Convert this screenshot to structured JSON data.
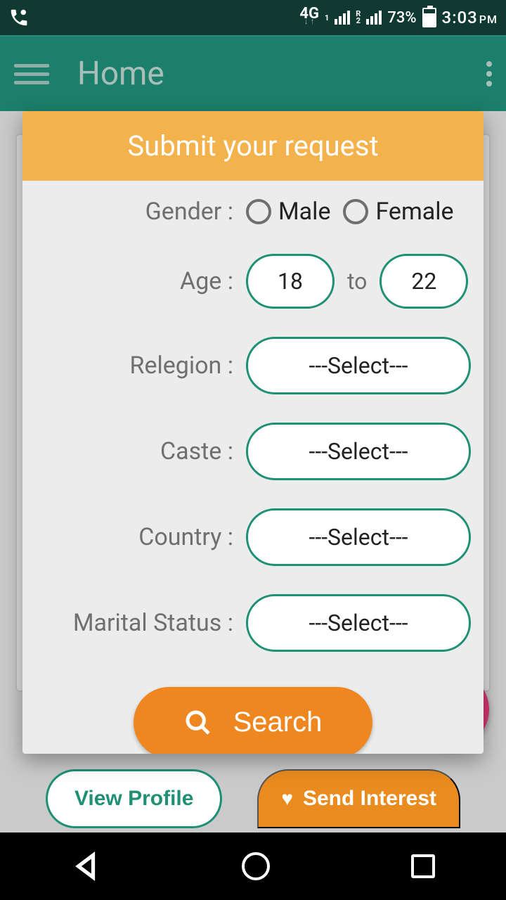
{
  "status": {
    "network_type": "4G",
    "sim1_sub": "1",
    "sim2_sub": "2",
    "sim2_roam": "R",
    "battery_pct": "73%",
    "time": "3:03",
    "ampm": "PM"
  },
  "appbar": {
    "title": "Home"
  },
  "modal": {
    "title": "Submit your request",
    "labels": {
      "gender": "Gender :",
      "age": "Age :",
      "religion": "Relegion :",
      "caste": "Caste :",
      "country": "Country :",
      "marital": "Marital Status :"
    },
    "gender_options": {
      "male": "Male",
      "female": "Female"
    },
    "age_from": "18",
    "age_to_word": "to",
    "age_to": "22",
    "select_placeholder": "---Select---",
    "search_label": "Search"
  },
  "backdrop": {
    "view_profile": "View Profile",
    "send_interest": "Send Interest"
  }
}
